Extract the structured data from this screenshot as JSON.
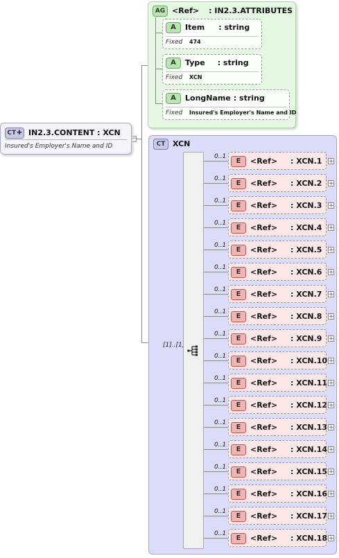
{
  "root": {
    "badge": "CT",
    "title": "IN2.3.CONTENT : XCN",
    "doc": "Insured's Employer's Name and ID"
  },
  "attribute_group": {
    "badge": "AG",
    "ref": "<Ref>",
    "name": ": IN2.3.ATTRIBUTES",
    "attributes": [
      {
        "badge": "A",
        "name": "Item",
        "type": ": string",
        "fixed_label": "Fixed",
        "fixed_value": "474"
      },
      {
        "badge": "A",
        "name": "Type",
        "type": ": string",
        "fixed_label": "Fixed",
        "fixed_value": "XCN"
      },
      {
        "badge": "A",
        "name": "LongName",
        "type": ": string",
        "fixed_label": "Fixed",
        "fixed_value": "Insured's Employer's Name and ID"
      }
    ]
  },
  "complex_type": {
    "badge": "CT",
    "name": "XCN",
    "sequence_occurrence": "[1]..[1]",
    "elements": [
      {
        "occ": "0..1",
        "badge": "E",
        "ref": "<Ref>",
        "name": ": XCN.1"
      },
      {
        "occ": "0..1",
        "badge": "E",
        "ref": "<Ref>",
        "name": ": XCN.2"
      },
      {
        "occ": "0..1",
        "badge": "E",
        "ref": "<Ref>",
        "name": ": XCN.3"
      },
      {
        "occ": "0..1",
        "badge": "E",
        "ref": "<Ref>",
        "name": ": XCN.4"
      },
      {
        "occ": "0..1",
        "badge": "E",
        "ref": "<Ref>",
        "name": ": XCN.5"
      },
      {
        "occ": "0..1",
        "badge": "E",
        "ref": "<Ref>",
        "name": ": XCN.6"
      },
      {
        "occ": "0..1",
        "badge": "E",
        "ref": "<Ref>",
        "name": ": XCN.7"
      },
      {
        "occ": "0..1",
        "badge": "E",
        "ref": "<Ref>",
        "name": ": XCN.8"
      },
      {
        "occ": "0..1",
        "badge": "E",
        "ref": "<Ref>",
        "name": ": XCN.9"
      },
      {
        "occ": "0..1",
        "badge": "E",
        "ref": "<Ref>",
        "name": ": XCN.10"
      },
      {
        "occ": "0..1",
        "badge": "E",
        "ref": "<Ref>",
        "name": ": XCN.11"
      },
      {
        "occ": "0..1",
        "badge": "E",
        "ref": "<Ref>",
        "name": ": XCN.12"
      },
      {
        "occ": "0..1",
        "badge": "E",
        "ref": "<Ref>",
        "name": ": XCN.13"
      },
      {
        "occ": "0..1",
        "badge": "E",
        "ref": "<Ref>",
        "name": ": XCN.14"
      },
      {
        "occ": "0..1",
        "badge": "E",
        "ref": "<Ref>",
        "name": ": XCN.15"
      },
      {
        "occ": "0..1",
        "badge": "E",
        "ref": "<Ref>",
        "name": ": XCN.16"
      },
      {
        "occ": "0..1",
        "badge": "E",
        "ref": "<Ref>",
        "name": ": XCN.17"
      },
      {
        "occ": "0..1",
        "badge": "E",
        "ref": "<Ref>",
        "name": ": XCN.18"
      }
    ]
  },
  "icons": {
    "expand": "plus-icon",
    "sequence": "sequence-compositor-icon",
    "collapse": "minus-icon"
  }
}
